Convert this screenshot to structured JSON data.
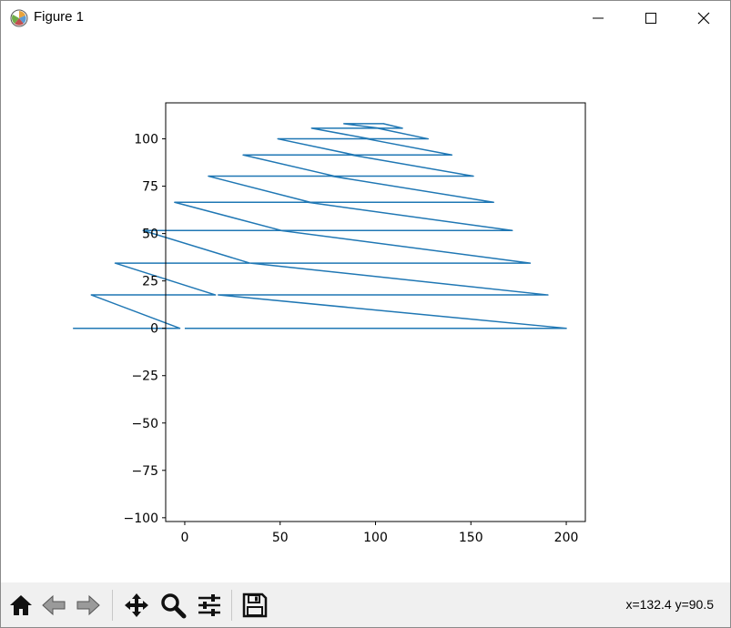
{
  "window": {
    "title": "Figure 1",
    "icons": {
      "app": "matplotlib-icon",
      "minimize": "minimize-icon",
      "maximize": "maximize-icon",
      "close": "close-icon"
    }
  },
  "toolbar": {
    "buttons": [
      {
        "name": "home",
        "icon": "home-icon"
      },
      {
        "name": "back",
        "icon": "arrow-left-icon"
      },
      {
        "name": "forward",
        "icon": "arrow-right-icon"
      },
      {
        "name": "pan",
        "icon": "move-icon"
      },
      {
        "name": "zoom",
        "icon": "magnifier-icon"
      },
      {
        "name": "configure-subplots",
        "icon": "sliders-icon"
      },
      {
        "name": "save",
        "icon": "floppy-disk-icon"
      }
    ],
    "coordinates": "x=132.4 y=90.5"
  },
  "chart_data": {
    "type": "line",
    "title": "",
    "xlabel": "",
    "ylabel": "",
    "xlim": [
      -10,
      210
    ],
    "ylim": [
      -102,
      119
    ],
    "xticks": [
      0,
      50,
      100,
      150,
      200
    ],
    "yticks": [
      -100,
      -75,
      -50,
      -25,
      0,
      25,
      50,
      75,
      100
    ],
    "xtick_labels": [
      "0",
      "50",
      "100",
      "150",
      "200"
    ],
    "ytick_labels": [
      "−100",
      "−75",
      "−50",
      "−25",
      "0",
      "25",
      "50",
      "75",
      "100"
    ],
    "grid": false,
    "line_color": "#1f77b4",
    "series": [
      {
        "x": [
          0,
          200,
          17.6,
          190.4,
          34.5,
          181.1,
          50.2,
          171.7,
          64.5,
          161.9,
          76.9,
          151.3,
          87.3,
          140.0,
          95.4,
          127.6,
          101.1,
          114.1,
          104.1,
          99.3,
          104.4,
          83.4,
          102.0,
          66.5,
          96.8,
          48.8,
          89.0,
          30.6,
          78.6,
          12.4,
          65.8,
          -5.3,
          50.8,
          -21.8,
          34.1,
          -36.5,
          16.1,
          -49.0,
          -2.6,
          -58.6
        ],
        "y": [
          0,
          0,
          17.6,
          17.6,
          34.4,
          34.4,
          51.6,
          51.6,
          66.5,
          66.5,
          80.3,
          80.3,
          91.5,
          91.5,
          100.0,
          100.0,
          105.6,
          105.6,
          108.0,
          108.0,
          108.0,
          108.0,
          105.6,
          105.6,
          100.0,
          100.0,
          91.5,
          91.5,
          80.3,
          80.3,
          66.5,
          66.5,
          51.6,
          51.6,
          34.4,
          34.4,
          17.6,
          17.6,
          0,
          0
        ]
      }
    ]
  }
}
